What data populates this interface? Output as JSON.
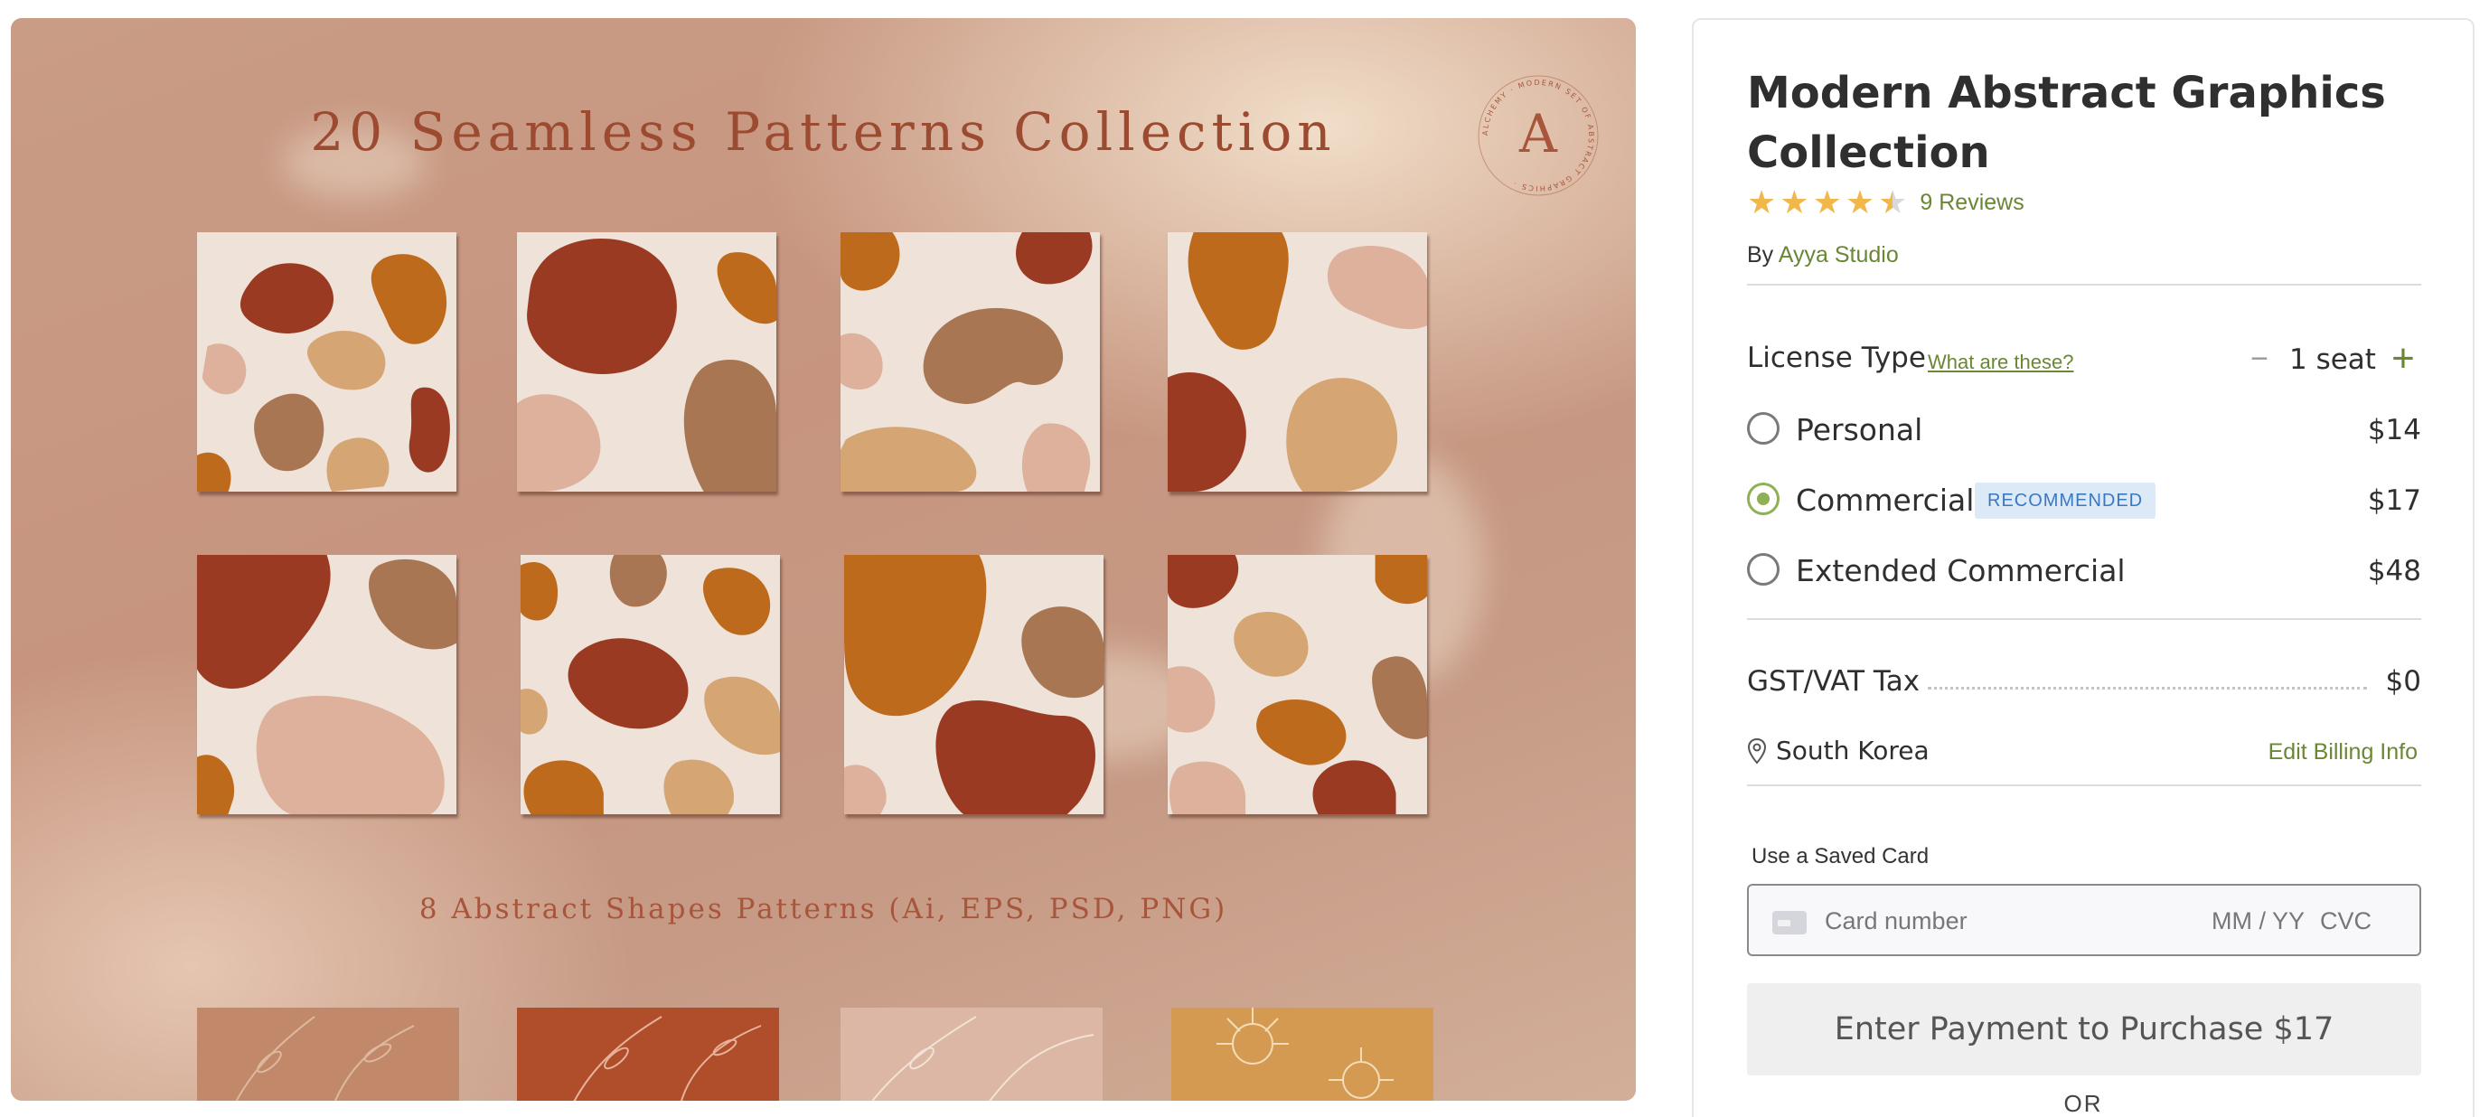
{
  "preview": {
    "title": "20 Seamless Patterns Collection",
    "subtitle": "8 Abstract Shapes Patterns (Ai, EPS, PSD, PNG)",
    "logo_letter": "A",
    "logo_ring_text": "ALCHEMY · MODERN SET OF ABSTRACT GRAPHICS ·",
    "colors": {
      "rust": "#9b3a22",
      "ochre": "#bd6a1c",
      "tan": "#a97654",
      "sand": "#d6a574",
      "blush": "#ddb19c",
      "cream": "#efe2d8"
    }
  },
  "product": {
    "title": "Modern Abstract Graphics Collection",
    "rating": 4.5,
    "reviews_label": "9 Reviews",
    "by_prefix": "By",
    "author": "Ayya Studio"
  },
  "license": {
    "label": "License Type",
    "help_link": "What are these?",
    "seat_minus": "−",
    "seat_count": "1 seat",
    "seat_plus": "+",
    "options": [
      {
        "label": "Personal",
        "price": "$14",
        "selected": false,
        "badge": ""
      },
      {
        "label": "Commercial",
        "price": "$17",
        "selected": true,
        "badge": "RECOMMENDED"
      },
      {
        "label": "Extended Commercial",
        "price": "$48",
        "selected": false,
        "badge": ""
      }
    ]
  },
  "tax": {
    "label": "GST/VAT Tax",
    "value": "$0"
  },
  "billing": {
    "country": "South Korea",
    "edit_link": "Edit Billing Info"
  },
  "payment": {
    "saved_card_label": "Use a Saved Card",
    "card_number_placeholder": "Card number",
    "expiry_placeholder": "MM / YY",
    "cvc_placeholder": "CVC",
    "purchase_button": "Enter Payment to Purchase $17",
    "or_label": "OR"
  },
  "theme": {
    "accent_green": "#6a8734",
    "radio_green": "#8fb054",
    "badge_bg": "#dce9f7",
    "badge_text": "#3a78c2",
    "star": "#f2b74a"
  }
}
